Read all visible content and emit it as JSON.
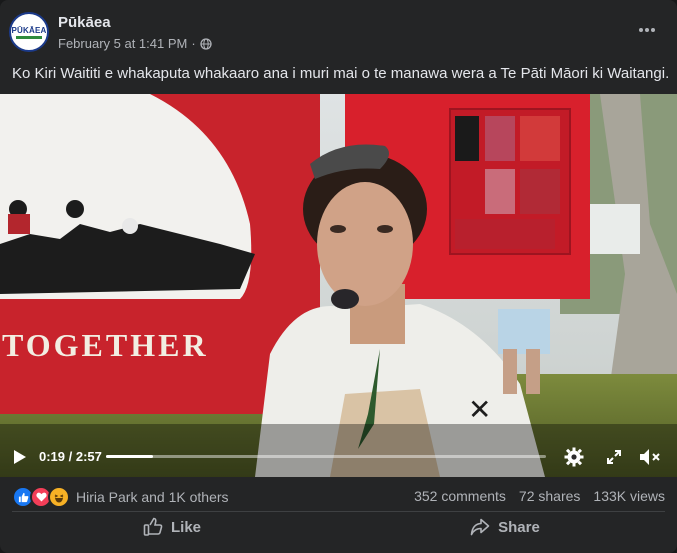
{
  "post": {
    "page_name": "Pūkāea",
    "avatar_text": "PŪKĀEA",
    "date": "February 5 at 1:41 PM",
    "separator": "·",
    "caption": "Ko Kiri Waititi e whakaputa whakaaro ana i muri mai o te manawa wera a Te Pāti Māori ki Waitangi."
  },
  "video": {
    "banner_text": "TOGETHER",
    "current_time": "0:19",
    "duration": "2:57",
    "time_label": "0:19 / 2:57",
    "progress": 0.107
  },
  "stats": {
    "reactions_label": "Hiria Park and 1K others",
    "comments": "352 comments",
    "shares": "72 shares",
    "views": "133K views"
  },
  "actions": {
    "like": "Like",
    "share": "Share"
  },
  "icons": {
    "globe": "globe-icon",
    "more": "more-dots-icon",
    "play": "play-icon",
    "settings": "gear-icon",
    "fullscreen": "fullscreen-icon",
    "volume": "volume-muted-icon",
    "like_reaction": "like-reaction-icon",
    "love_reaction": "love-reaction-icon",
    "haha_reaction": "haha-reaction-icon",
    "like_action": "thumbs-up-icon",
    "share_action": "share-arrow-icon"
  },
  "colors": {
    "background": "#242526",
    "text_primary": "#e4e6eb",
    "text_secondary": "#b0b3b8",
    "like_blue": "#1877f2",
    "love_red": "#f33e58",
    "haha_yellow": "#f7b125"
  }
}
